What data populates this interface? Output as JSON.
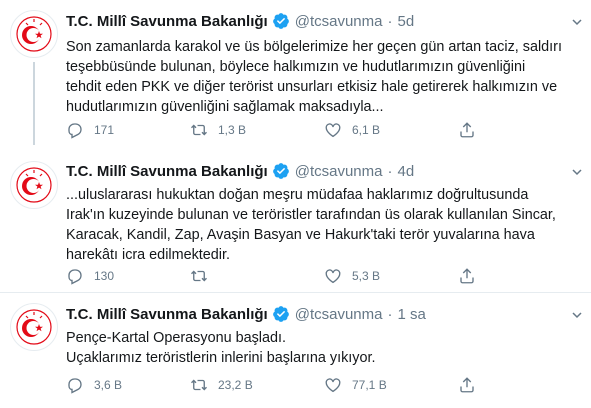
{
  "tweets": [
    {
      "name": "T.C. Millî Savunma Bakanlığı",
      "handle": "@tcsavunma",
      "time": "5d",
      "text_lines": [
        "Son zamanlarda karakol ve üs bölgelerimize her geçen gün artan taciz, saldırı",
        "teşebbüsünde bulunan, böylece halkımızın ve hudutlarımızın güvenliğini",
        "tehdit eden PKK ve diğer terörist unsurları etkisiz hale getirerek halkımızın ve",
        "hudutlarımızın güvenliğini sağlamak maksadıyla..."
      ],
      "replies": "171",
      "retweets": "1,3 B",
      "likes": "6,1 B"
    },
    {
      "name": "T.C. Millî Savunma Bakanlığı",
      "handle": "@tcsavunma",
      "time": "4d",
      "text_lines": [
        "...uluslararası hukuktan doğan meşru müdafaa haklarımız doğrultusunda",
        "Irak'ın kuzeyinde bulunan ve teröristler tarafından üs olarak kullanılan Sincar,",
        "Karacak, Kandil, Zap, Avaşin Basyan ve Hakurk'taki terör yuvalarına hava",
        "harekâtı icra edilmektedir."
      ],
      "replies": "130",
      "retweets": "",
      "likes": "5,3 B"
    },
    {
      "name": "T.C. Millî Savunma Bakanlığı",
      "handle": "@tcsavunma",
      "time": "1 sa",
      "text_lines": [
        "Pençe-Kartal Operasyonu başladı.",
        "Uçaklarımız teröristlerin inlerini başlarına yıkıyor."
      ],
      "replies": "3,6 B",
      "retweets": "23,2 B",
      "likes": "77,1 B"
    }
  ],
  "colors": {
    "accent": "#1da1f2",
    "muted": "#657786",
    "text": "#14171a",
    "logo": "#e30a17"
  },
  "icons": [
    "verified-badge-icon",
    "chevron-down-icon",
    "reply-icon",
    "retweet-icon",
    "like-icon",
    "share-icon"
  ]
}
